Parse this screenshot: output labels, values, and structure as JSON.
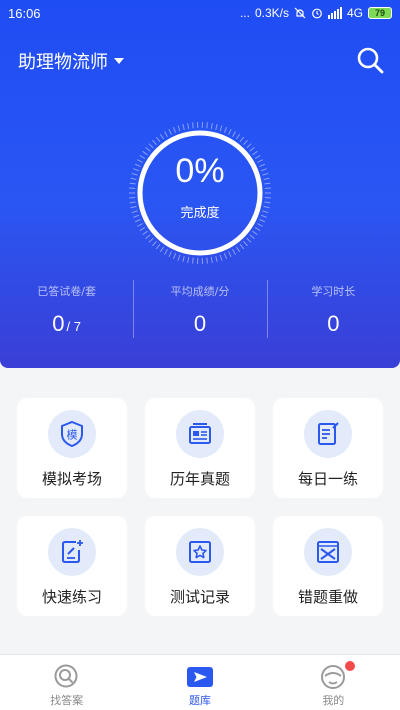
{
  "status_bar": {
    "time": "16:06",
    "dots": "...",
    "network_speed": "0.3K/s",
    "network_type": "4G",
    "battery": "79"
  },
  "header": {
    "subject_title": "助理物流师",
    "icons": [
      "chevron-down-icon",
      "search-icon"
    ]
  },
  "progress": {
    "percent_text": "0%",
    "label": "完成度",
    "fraction": 0
  },
  "stats": [
    {
      "label": "已答试卷/套",
      "value": "0",
      "total": "/ 7"
    },
    {
      "label": "平均成绩/分",
      "value": "0"
    },
    {
      "label": "学习时长",
      "value": "0"
    }
  ],
  "features": [
    {
      "label": "模拟考场",
      "icon": "exam-shield-icon",
      "glyph": "模"
    },
    {
      "label": "历年真题",
      "icon": "past-papers-icon"
    },
    {
      "label": "每日一练",
      "icon": "daily-practice-icon"
    },
    {
      "label": "快速练习",
      "icon": "quick-practice-icon"
    },
    {
      "label": "测试记录",
      "icon": "test-record-icon"
    },
    {
      "label": "错题重做",
      "icon": "wrong-questions-icon"
    }
  ],
  "bottom_nav": [
    {
      "label": "找答案",
      "icon": "search-answer-icon",
      "active": false
    },
    {
      "label": "题库",
      "icon": "question-bank-icon",
      "active": true
    },
    {
      "label": "我的",
      "icon": "profile-icon",
      "active": false,
      "badge": true
    }
  ],
  "colors": {
    "primary": "#2b58ef",
    "hero_gradient_top": "#1f4df4",
    "hero_gradient_bottom": "#3a3fd6",
    "icon_bg": "#e3ebfb",
    "badge": "#f24a4a",
    "card_bg": "#ffffff",
    "page_bg": "#f4f5f7"
  }
}
